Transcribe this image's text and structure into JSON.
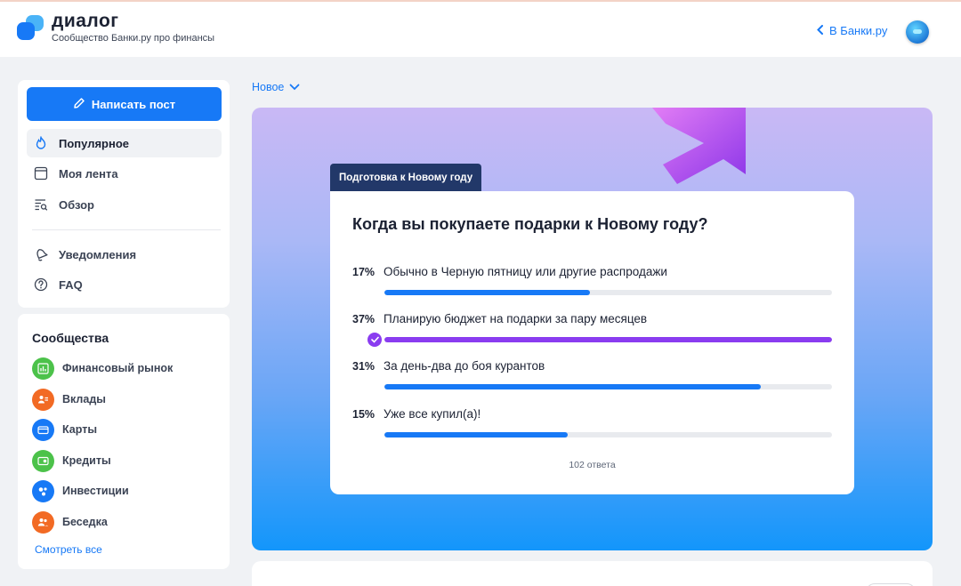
{
  "header": {
    "brand_name": "диалог",
    "brand_subtitle": "Сообщество Банки.ру про финансы",
    "back_link": "В Банки.ру"
  },
  "sidebar": {
    "write_button": "Написать пост",
    "nav": [
      {
        "label": "Популярное",
        "icon": "fire-icon",
        "active": true
      },
      {
        "label": "Моя лента",
        "icon": "feed-icon"
      },
      {
        "label": "Обзор",
        "icon": "overview-icon"
      },
      {
        "label": "Уведомления",
        "icon": "bell-icon"
      },
      {
        "label": "FAQ",
        "icon": "question-icon"
      }
    ],
    "communities_title": "Сообщества",
    "communities": [
      {
        "label": "Финансовый рынок",
        "icon": "chart-icon",
        "color": "#4cc24a"
      },
      {
        "label": "Вклады",
        "icon": "deposit-icon",
        "color": "#f26a24"
      },
      {
        "label": "Карты",
        "icon": "card-icon",
        "color": "#1779f6"
      },
      {
        "label": "Кредиты",
        "icon": "credit-icon",
        "color": "#4cc24a"
      },
      {
        "label": "Инвестиции",
        "icon": "invest-icon",
        "color": "#1779f6"
      },
      {
        "label": "Беседка",
        "icon": "chat-icon",
        "color": "#f26a24"
      }
    ],
    "see_all": "Смотреть все"
  },
  "feed": {
    "sort_label": "Новое"
  },
  "poll": {
    "tag": "Подготовка к Новому году",
    "question": "Когда вы покупаете подарки к Новому году?",
    "options": [
      {
        "percent": "17%",
        "label": "Обычно в Черную пятницу или другие распродажи",
        "fill": 0.46,
        "voted": false
      },
      {
        "percent": "37%",
        "label": "Планирую бюджет на подарки за пару месяцев",
        "fill": 1.0,
        "voted": true
      },
      {
        "percent": "31%",
        "label": "За день-два до боя курантов",
        "fill": 0.84,
        "voted": false
      },
      {
        "percent": "15%",
        "label": "Уже все купил(а)!",
        "fill": 0.41,
        "voted": false
      }
    ],
    "votes": "102 ответа"
  },
  "colors": {
    "accent": "#1779f6",
    "voted": "#8a3cf0",
    "tag_bg": "#223869"
  }
}
